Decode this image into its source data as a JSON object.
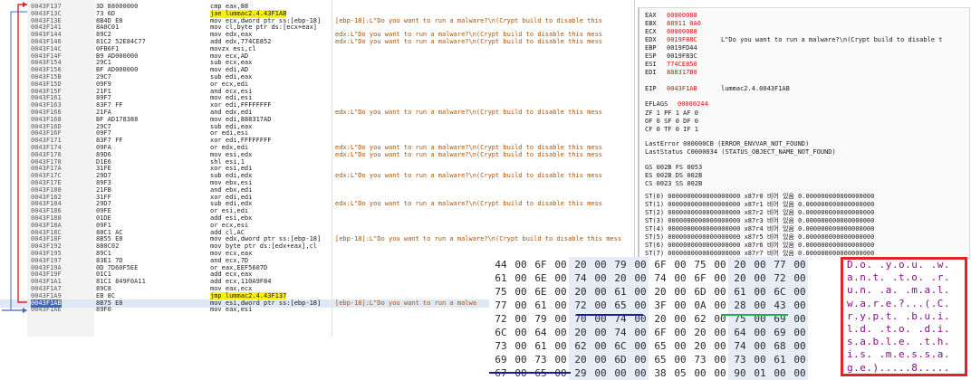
{
  "disassembly": {
    "rows": [
      {
        "addr": "0043F137",
        "bytes": "3D 88000000",
        "instr": "cmp eax,88",
        "comment": ""
      },
      {
        "addr": "0043F13C",
        "bytes": "73 6D",
        "instr": "jae lummac2.4.43F1AB",
        "comment": "",
        "hl": "yellow"
      },
      {
        "addr": "0043F13E",
        "bytes": "8B4D E8",
        "instr": "mov ecx,dword ptr ss:[ebp-18]",
        "comment": "[ebp-18]:L\"Do you want to run a malware?\\n(Crypt build to disable this"
      },
      {
        "addr": "0043F141",
        "bytes": "8A0C01",
        "instr": "mov cl,byte ptr ds:[ecx+eax]",
        "comment": ""
      },
      {
        "addr": "0043F144",
        "bytes": "89C2",
        "instr": "mov edx,eax",
        "comment": "edx:L\"Do you want to run a malware?\\n(Crypt build to disable this mess"
      },
      {
        "addr": "0043F146",
        "bytes": "81C2 52E84C77",
        "instr": "add edx,774CE852",
        "comment": "edx:L\"Do you want to run a malware?\\n(Crypt build to disable this mess"
      },
      {
        "addr": "0043F14C",
        "bytes": "0FB6F1",
        "instr": "movzx esi,cl",
        "comment": ""
      },
      {
        "addr": "0043F14F",
        "bytes": "B9 AD000000",
        "instr": "mov ecx,AD",
        "comment": ""
      },
      {
        "addr": "0043F154",
        "bytes": "29C1",
        "instr": "sub ecx,eax",
        "comment": ""
      },
      {
        "addr": "0043F156",
        "bytes": "BF AD000000",
        "instr": "mov edi,AD",
        "comment": ""
      },
      {
        "addr": "0043F15B",
        "bytes": "29C7",
        "instr": "sub edi,eax",
        "comment": ""
      },
      {
        "addr": "0043F15D",
        "bytes": "09F9",
        "instr": "or ecx,edi",
        "comment": ""
      },
      {
        "addr": "0043F15F",
        "bytes": "21F1",
        "instr": "and ecx,esi",
        "comment": ""
      },
      {
        "addr": "0043F161",
        "bytes": "89F7",
        "instr": "mov edi,esi",
        "comment": ""
      },
      {
        "addr": "0043F163",
        "bytes": "83F7 FF",
        "instr": "xor edi,FFFFFFFF",
        "comment": ""
      },
      {
        "addr": "0043F166",
        "bytes": "21FA",
        "instr": "and edx,edi",
        "comment": "edx:L\"Do you want to run a malware?\\n(Crypt build to disable this mess"
      },
      {
        "addr": "0043F168",
        "bytes": "BF AD178388",
        "instr": "mov edi,888317AD",
        "comment": ""
      },
      {
        "addr": "0043F16D",
        "bytes": "29C7",
        "instr": "sub edi,eax",
        "comment": ""
      },
      {
        "addr": "0043F16F",
        "bytes": "09F7",
        "instr": "or edi,esi",
        "comment": ""
      },
      {
        "addr": "0043F171",
        "bytes": "83F7 FF",
        "instr": "xor edi,FFFFFFFF",
        "comment": ""
      },
      {
        "addr": "0043F174",
        "bytes": "09FA",
        "instr": "or edx,edi",
        "comment": "edx:L\"Do you want to run a malware?\\n(Crypt build to disable this mess"
      },
      {
        "addr": "0043F176",
        "bytes": "89D6",
        "instr": "mov esi,edx",
        "comment": "edx:L\"Do you want to run a malware?\\n(Crypt build to disable this mess"
      },
      {
        "addr": "0043F178",
        "bytes": "D1E6",
        "instr": "shl esi,1",
        "comment": ""
      },
      {
        "addr": "0043F17A",
        "bytes": "31FE",
        "instr": "xor esi,edi",
        "comment": ""
      },
      {
        "addr": "0043F17C",
        "bytes": "29D7",
        "instr": "sub edi,edx",
        "comment": "edx:L\"Do you want to run a malware?\\n(Crypt build to disable this mess"
      },
      {
        "addr": "0043F17E",
        "bytes": "89F3",
        "instr": "mov ebx,esi",
        "comment": ""
      },
      {
        "addr": "0043F180",
        "bytes": "21FB",
        "instr": "and ebx,edi",
        "comment": ""
      },
      {
        "addr": "0043F182",
        "bytes": "31FF",
        "instr": "xor edi,edi",
        "comment": ""
      },
      {
        "addr": "0043F184",
        "bytes": "29D7",
        "instr": "sub edi,edx",
        "comment": "edx:L\"Do you want to run a malware?\\n(Crypt build to disable this mess"
      },
      {
        "addr": "0043F186",
        "bytes": "09FE",
        "instr": "or esi,edi",
        "comment": ""
      },
      {
        "addr": "0043F188",
        "bytes": "01DE",
        "instr": "add esi,ebx",
        "comment": ""
      },
      {
        "addr": "0043F18A",
        "bytes": "09F1",
        "instr": "or ecx,esi",
        "comment": ""
      },
      {
        "addr": "0043F18C",
        "bytes": "80C1 AC",
        "instr": "add cl,AC",
        "comment": ""
      },
      {
        "addr": "0043F18F",
        "bytes": "8B55 E8",
        "instr": "mov edx,dword ptr ss:[ebp-18]",
        "comment": "[ebp-18]:L\"Do you want to run a malware?\\n(Crypt build to disable this mess"
      },
      {
        "addr": "0043F192",
        "bytes": "880C02",
        "instr": "mov byte ptr ds:[edx+eax],cl",
        "comment": ""
      },
      {
        "addr": "0043F195",
        "bytes": "89C1",
        "instr": "mov ecx,eax",
        "comment": ""
      },
      {
        "addr": "0043F197",
        "bytes": "83E1 7D",
        "instr": "and ecx,7D",
        "comment": ""
      },
      {
        "addr": "0043F19A",
        "bytes": "0D 7D60F5EE",
        "instr": "or eax,EEF5607D",
        "comment": ""
      },
      {
        "addr": "0043F19F",
        "bytes": "01C1",
        "instr": "add ecx,eax",
        "comment": ""
      },
      {
        "addr": "0043F1A1",
        "bytes": "81C1 849F0A11",
        "instr": "add ecx,110A9F84",
        "comment": ""
      },
      {
        "addr": "0043F1A7",
        "bytes": "89C8",
        "instr": "mov eax,ecx",
        "comment": ""
      },
      {
        "addr": "0043F1A9",
        "bytes": "EB 8C",
        "instr": "jmp lummac2.4.43F137",
        "comment": "",
        "hl": "yellow"
      },
      {
        "addr": "0043F1AB",
        "bytes": "8B75 E8",
        "instr": "mov esi,dword ptr ss:[ebp-18]",
        "comment": "[ebp-18]:L\"Do you want to run a malwa",
        "hl": "blue"
      },
      {
        "addr": "0043F1AE",
        "bytes": "89F0",
        "instr": "mov eax,esi",
        "comment": ""
      }
    ]
  },
  "registers": {
    "lines": [
      {
        "name": "EAX",
        "value": "00000088",
        "note": ""
      },
      {
        "name": "EBX",
        "value": "88911 0A0",
        "note": ""
      },
      {
        "name": "ECX",
        "value": "00000088",
        "note": ""
      },
      {
        "name": "EDX",
        "value": "0019F88C",
        "note": "L\"Do you want to run a malware?\\n(Crypt build to disable t"
      },
      {
        "name": "EBP",
        "value": "0019FD44",
        "note": "",
        "plain": true
      },
      {
        "name": "ESP",
        "value": "0019F83C",
        "note": "",
        "plain": true
      },
      {
        "name": "ESI",
        "value": "774CE850",
        "note": ""
      },
      {
        "name": "EDI",
        "value": "888317B0",
        "note": ""
      },
      {
        "name": "",
        "value": "",
        "note": ""
      },
      {
        "name": "EIP",
        "value": "0043F1AB",
        "note": "lummac2.4.0043F1AB"
      }
    ],
    "eflags_label": "EFLAGS",
    "eflags_value": "00000244",
    "flags_rows": [
      "ZF 1  PF 1  AF 0",
      "OF 0  SF 0  DF 0",
      "CF 0  TF 0  IF 1"
    ],
    "last_error": "LastError  000000CB (ERROR_ENVVAR_NOT_FOUND)",
    "last_status": "LastStatus C0000034 (STATUS_OBJECT_NAME_NOT_FOUND)",
    "segments": [
      "GS 002B  FS 0053",
      "ES 002B  DS 002B",
      "CS 0023  SS 002B"
    ],
    "st_rows": [
      "ST(0) 0000000000000000000 x87r0 비어 있음 0.000000000000000000",
      "ST(1) 0000000000000000000 x87r1 비어 있음 0.000000000000000000",
      "ST(2) 0000000000000000000 x87r2 비어 있음 0.000000000000000000",
      "ST(3) 0000000000000000000 x87r3 비어 있음 0.000000000000000000",
      "ST(4) 0000000000000000000 x87r4 비어 있음 0.000000000000000000",
      "ST(5) 0000000000000000000 x87r5 비어 있음 0.000000000000000000",
      "ST(6) 0000000000000000000 x87r6 비어 있음 0.000000000000000000",
      "ST(7) 0000000000000000000 x87r7 비어 있음 0.000000000000000000"
    ]
  },
  "hexdump": {
    "rows": [
      [
        "44",
        "00",
        "6F",
        "00",
        "20",
        "00",
        "79",
        "00",
        "6F",
        "00",
        "75",
        "00",
        "20",
        "00",
        "77",
        "00"
      ],
      [
        "61",
        "00",
        "6E",
        "00",
        "74",
        "00",
        "20",
        "00",
        "74",
        "00",
        "6F",
        "00",
        "20",
        "00",
        "72",
        "00"
      ],
      [
        "75",
        "00",
        "6E",
        "00",
        "20",
        "00",
        "61",
        "00",
        "20",
        "00",
        "6D",
        "00",
        "61",
        "00",
        "6C",
        "00"
      ],
      [
        "77",
        "00",
        "61",
        "00",
        "72",
        "00",
        "65",
        "00",
        "3F",
        "00",
        "0A",
        "00",
        "28",
        "00",
        "43",
        "00"
      ],
      [
        "72",
        "00",
        "79",
        "00",
        "70",
        "00",
        "74",
        "00",
        "20",
        "00",
        "62",
        "00",
        "75",
        "00",
        "69",
        "00"
      ],
      [
        "6C",
        "00",
        "64",
        "00",
        "20",
        "00",
        "74",
        "00",
        "6F",
        "00",
        "20",
        "00",
        "64",
        "00",
        "69",
        "00"
      ],
      [
        "73",
        "00",
        "61",
        "00",
        "62",
        "00",
        "6C",
        "00",
        "65",
        "00",
        "20",
        "00",
        "74",
        "00",
        "68",
        "00"
      ],
      [
        "69",
        "00",
        "73",
        "00",
        "20",
        "00",
        "6D",
        "00",
        "65",
        "00",
        "73",
        "00",
        "73",
        "00",
        "61",
        "00"
      ],
      [
        "67",
        "00",
        "65",
        "00",
        "29",
        "00",
        "00",
        "00",
        "38",
        "05",
        "00",
        "00",
        "90",
        "01",
        "00",
        "00"
      ]
    ]
  },
  "ascii": {
    "rows": [
      "D.o. .y.o.u. .w.",
      "a.n.t. .t.o. .r.",
      "u.n. .a. .m.a.l.",
      "w.a.r.e.?...(.C.",
      "r.y.p.t. .b.u.i.",
      "l.d. .t.o. .d.i.",
      "s.a.b.l.e. .t.h.",
      "i.s. .m.e.s.s.a.",
      "g.e.).....8....."
    ]
  },
  "colors": {
    "highlight_yellow": "#fff200",
    "current_row_blue": "#3d6ab8",
    "register_changed_red": "#d41010",
    "ascii_border_red": "#e2242a",
    "ascii_text": "#8b0a8b",
    "comment_orange": "#b05000"
  }
}
